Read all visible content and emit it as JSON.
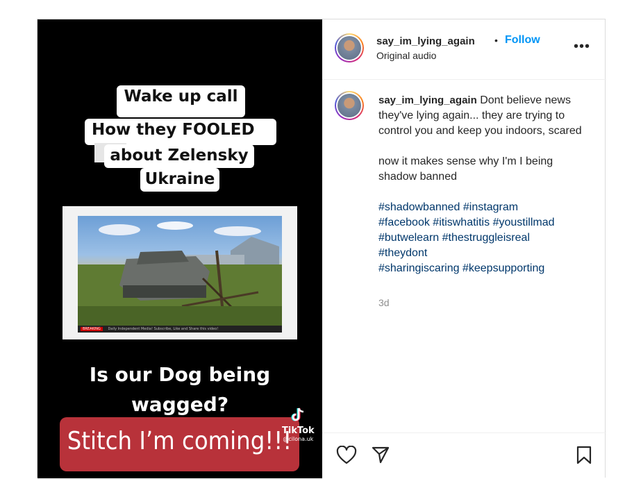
{
  "media": {
    "caption_title": "Wake up call",
    "caption_line1": "How they FOOLED",
    "caption_line2": "about Zelensky &",
    "caption_line3": "Ukraine",
    "ticker_label": "Daily Independent Media! Subscribe, Like and Share this video!",
    "ticker_brand": "BREAKING",
    "question_line1": "Is our Dog being",
    "question_line2": "wagged?",
    "stitch_text": "Stitch I’m coming!!!",
    "tiktok_brand": "TikTok",
    "tiktok_handle": "@cilona.uk"
  },
  "header": {
    "username": "say_im_lying_again",
    "separator": "•",
    "follow_label": "Follow",
    "audio": "Original audio",
    "more": "•••"
  },
  "caption": {
    "username": "say_im_lying_again",
    "text1": "Dont believe news they've lying again... they are trying to control you and keep you indoors, scared",
    "text2": "now it makes sense why I'm I being shadow banned",
    "hashtags": [
      "#shadowbanned",
      "#instagram",
      "#facebook",
      "#itiswhatitis",
      "#youstillmad",
      "#butwelearn",
      "#thestruggleisreal",
      "#theydont",
      "#sharingiscaring",
      "#keepsupporting"
    ],
    "time": "3d"
  },
  "colors": {
    "link": "#0095f6",
    "hashtag": "#00376b",
    "stitch_bg": "#b8323a"
  }
}
